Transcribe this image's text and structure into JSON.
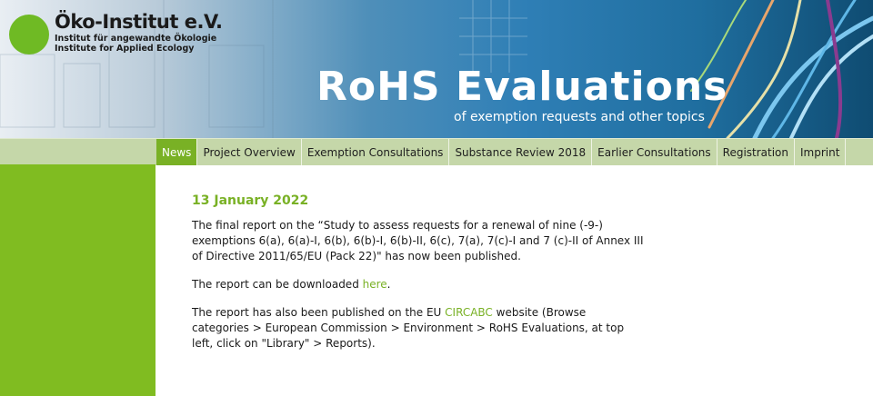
{
  "header": {
    "logo_name": "Öko-Institut e.V.",
    "logo_sub1": "Institut für angewandte Ökologie",
    "logo_sub2": "Institute for Applied Ecology",
    "title": "RoHS Evaluations",
    "subtitle": "of exemption requests and other topics"
  },
  "nav": {
    "items": [
      {
        "label": "News",
        "active": true
      },
      {
        "label": "Project Overview"
      },
      {
        "label": "Exemption Consultations"
      },
      {
        "label": "Substance Review 2018"
      },
      {
        "label": "Earlier Consultations"
      },
      {
        "label": "Registration"
      },
      {
        "label": "Imprint"
      }
    ]
  },
  "article": {
    "date": "13 January 2022",
    "p1": "The final report on the “Study to assess requests for a renewal of nine (-9-) exemptions 6(a), 6(a)-I, 6(b), 6(b)-I, 6(b)-II, 6(c), 7(a), 7(c)-I and 7 (c)-II of Annex III of Directive 2011/65/EU (Pack 22)\" has now been published.",
    "p2_before": "The report can be downloaded ",
    "p2_link": "here",
    "p2_after": ".",
    "p3_before": "The report has also been published on the EU ",
    "p3_link": "CIRCABC",
    "p3_after": " website (Browse categories > European Commission > Environment > RoHS Evaluations, at top left, click on \"Library\" > Reports)."
  },
  "colors": {
    "accent_green": "#79b125",
    "nav_bg": "#c5d7a9",
    "sidebar_green": "#80bc21",
    "banner_blue": "#2f7fb6"
  }
}
